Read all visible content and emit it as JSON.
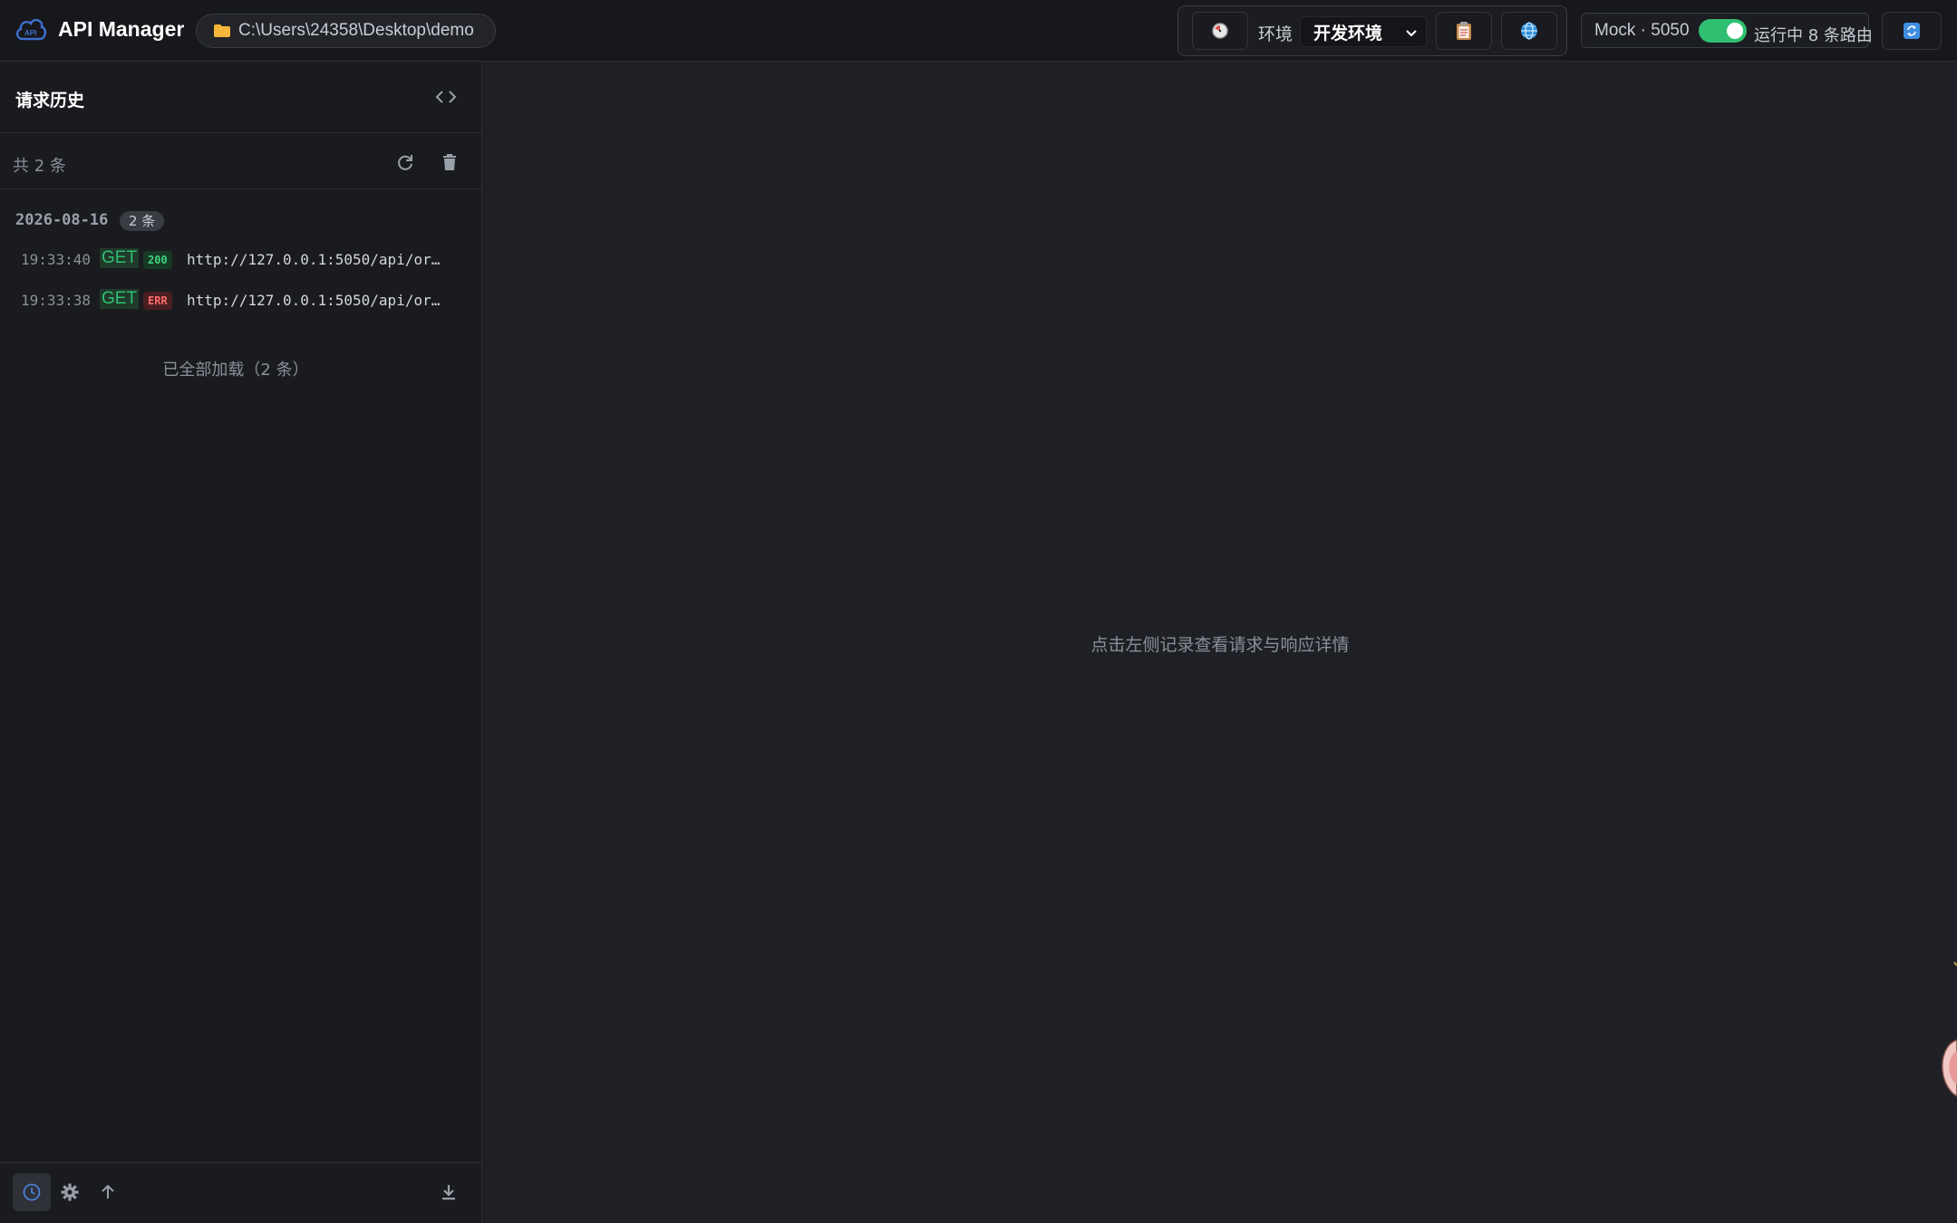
{
  "app": {
    "title": "API Manager"
  },
  "project": {
    "path": "C:\\Users\\24358\\Desktop\\demo"
  },
  "env": {
    "label": "环境",
    "selected": "开发环境"
  },
  "mock": {
    "label": "Mock · 5050",
    "enabled": true,
    "status": "运行中 8 条路由"
  },
  "sidebar": {
    "title": "请求历史",
    "count": "共 2 条",
    "groups": [
      {
        "date": "2026-08-16",
        "badge": "2 条",
        "items": [
          {
            "time": "19:33:40",
            "method": "GET",
            "status": "200",
            "url": "http://127.0.0.1:5050/api/or…"
          },
          {
            "time": "19:33:38",
            "method": "GET",
            "status": "ERR",
            "url": "http://127.0.0.1:5050/api/or…"
          }
        ]
      }
    ],
    "loaded_text": "已全部加载（2 条）"
  },
  "main": {
    "hint": "点击左侧记录查看请求与响应详情"
  },
  "icons": {
    "history": "clock-icon",
    "settings": "gear-icon",
    "upload": "arrow-up-icon",
    "download": "download-icon",
    "refresh": "refresh-icon",
    "trash": "trash-icon",
    "code": "code-icon",
    "globe": "globe-icon",
    "clipboard": "clipboard-icon",
    "reload": "reload-icon"
  },
  "colors": {
    "accent": "#2fbf71",
    "error": "#ff6b6b",
    "active_icon": "#4a7fd6"
  }
}
